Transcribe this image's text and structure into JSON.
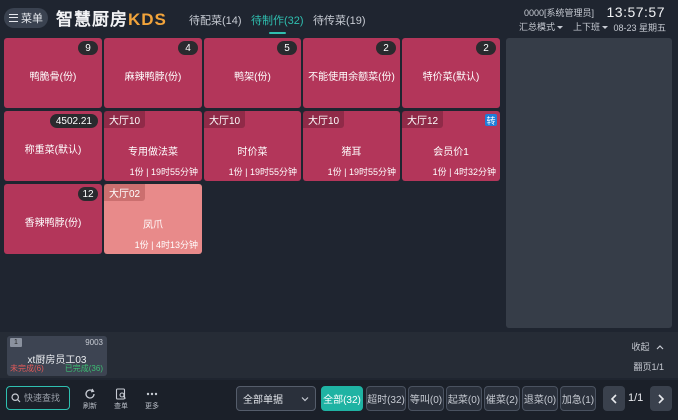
{
  "header": {
    "menu_label": "菜单",
    "brand_name": "智慧厨房",
    "brand_suffix": "KDS",
    "tabs": [
      {
        "label": "待配菜(14)"
      },
      {
        "label": "待制作(32)"
      },
      {
        "label": "待传菜(19)"
      }
    ],
    "user": "0000[系统管理员]",
    "mode_label": "汇总模式",
    "shift_label": "上下班",
    "time": "13:57:57",
    "date": "08-23 星期五"
  },
  "cards": [
    {
      "title": "鸭脆骨(份)",
      "count": "9"
    },
    {
      "title": "麻辣鸭脖(份)",
      "count": "4"
    },
    {
      "title": "鸭架(份)",
      "count": "5"
    },
    {
      "title": "不能使用余额菜(份)",
      "count": "2"
    },
    {
      "title": "特价菜(默认)",
      "count": "2"
    },
    {
      "title": "称重菜(默认)",
      "count": "4502.21"
    },
    {
      "title": "专用做法菜",
      "area": "大厅10",
      "footer": "1份 | 19时55分钟"
    },
    {
      "title": "时价菜",
      "area": "大厅10",
      "footer": "1份 | 19时55分钟"
    },
    {
      "title": "猪耳",
      "area": "大厅10",
      "footer": "1份 | 19时55分钟"
    },
    {
      "title": "会员价1",
      "area": "大厅12",
      "footer": "1份 | 4时32分钟",
      "flag": "转"
    },
    {
      "title": "香辣鸭脖(份)",
      "count": "12"
    },
    {
      "title": "凤爪",
      "area": "大厅02",
      "footer": "1份 | 4时13分钟"
    }
  ],
  "staff": {
    "index": "1",
    "id": "9003",
    "name": "xt厨房员工03",
    "todo": "未完成(6)",
    "done": "已完成(36)"
  },
  "panel": {
    "collapse_label": "收起",
    "page_info": "翻页1/1"
  },
  "bottom": {
    "search_placeholder": "快速查找",
    "tools": [
      {
        "label": "刷新",
        "icon": "refresh-icon"
      },
      {
        "label": "查单",
        "icon": "order-search-icon"
      },
      {
        "label": "更多",
        "icon": "more-icon"
      }
    ],
    "filter_value": "全部单据",
    "filters": [
      {
        "label": "全部(32)"
      },
      {
        "label": "超时(32)"
      },
      {
        "label": "等叫(0)"
      },
      {
        "label": "起菜(0)"
      },
      {
        "label": "催菜(2)"
      },
      {
        "label": "退菜(0)"
      },
      {
        "label": "加急(1)"
      }
    ],
    "page": "1/1"
  },
  "colors": {
    "card": "#b3365a",
    "card_alt": "#e88a8a",
    "accent": "#1fb3a3",
    "background": "#1f2530"
  }
}
